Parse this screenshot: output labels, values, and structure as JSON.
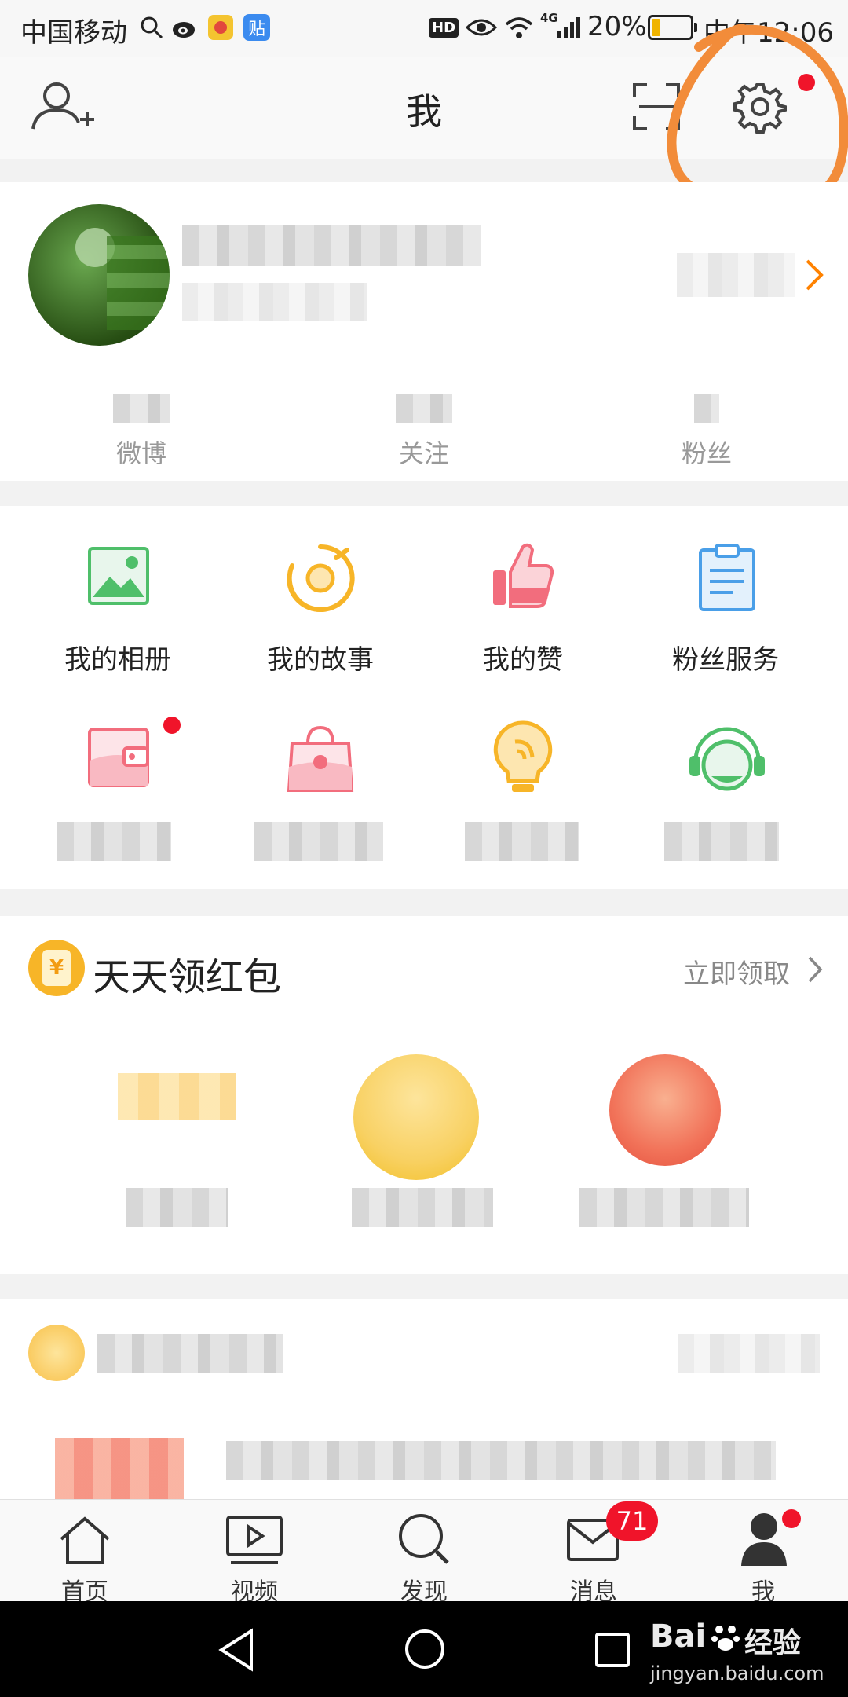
{
  "status_bar": {
    "carrier": "中国移动",
    "network_badge": "HD",
    "signal_type": "4G",
    "battery": "20%",
    "time": "中午12:06"
  },
  "header": {
    "title": "我"
  },
  "profile_stats": [
    {
      "label": "微博"
    },
    {
      "label": "关注"
    },
    {
      "label": "粉丝"
    }
  ],
  "features": [
    {
      "label": "我的相册",
      "icon": "album-icon"
    },
    {
      "label": "我的故事",
      "icon": "story-icon"
    },
    {
      "label": "我的赞",
      "icon": "thumbs-up-icon"
    },
    {
      "label": "粉丝服务",
      "icon": "clipboard-icon"
    }
  ],
  "redpacket": {
    "title": "天天领红包",
    "action": "立即领取",
    "coin_glyph": "¥"
  },
  "tabs": [
    {
      "label": "首页",
      "icon": "home-icon"
    },
    {
      "label": "视频",
      "icon": "video-icon"
    },
    {
      "label": "发现",
      "icon": "discover-icon"
    },
    {
      "label": "消息",
      "icon": "message-icon",
      "badge": "71"
    },
    {
      "label": "我",
      "icon": "profile-icon"
    }
  ],
  "watermark": {
    "brand": "Bai",
    "brand_cn": "经验",
    "url": "jingyan.baidu.com"
  },
  "colors": {
    "accent": "#ff8200",
    "badge_red": "#f0142a",
    "annotation": "#f28c3a"
  }
}
